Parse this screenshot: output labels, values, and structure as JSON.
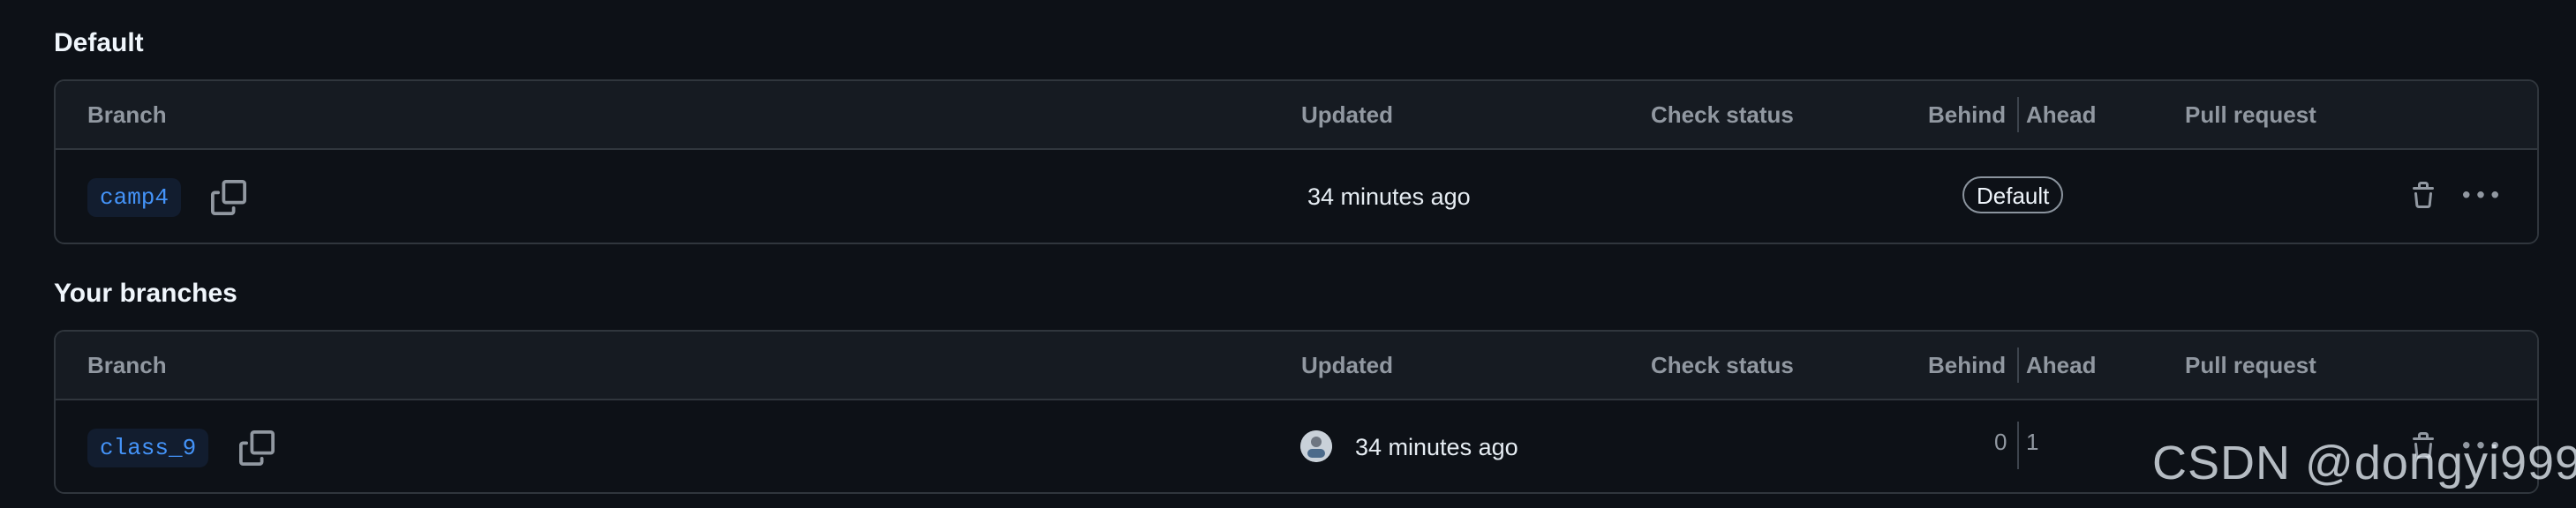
{
  "colors": {
    "background": "#0d1117",
    "header_bg": "#161b22",
    "border": "#30363d",
    "muted_text": "#9198a1",
    "branch_link": "#4493f8"
  },
  "columns": {
    "branch": "Branch",
    "updated": "Updated",
    "check_status": "Check status",
    "behind": "Behind",
    "ahead": "Ahead",
    "pull_request": "Pull request"
  },
  "default_section": {
    "title": "Default",
    "row": {
      "branch": "camp4",
      "updated": "34 minutes ago",
      "badge": "Default",
      "icons": [
        "copy-icon",
        "trash-icon",
        "kebab-menu-icon"
      ]
    }
  },
  "your_branches_section": {
    "title": "Your branches",
    "row": {
      "branch": "class_9",
      "updated": "34 minutes ago",
      "behind": "0",
      "ahead": "1",
      "icons": [
        "copy-icon",
        "avatar",
        "trash-icon",
        "kebab-menu-icon"
      ]
    }
  },
  "watermark": "CSDN @dongyi999"
}
